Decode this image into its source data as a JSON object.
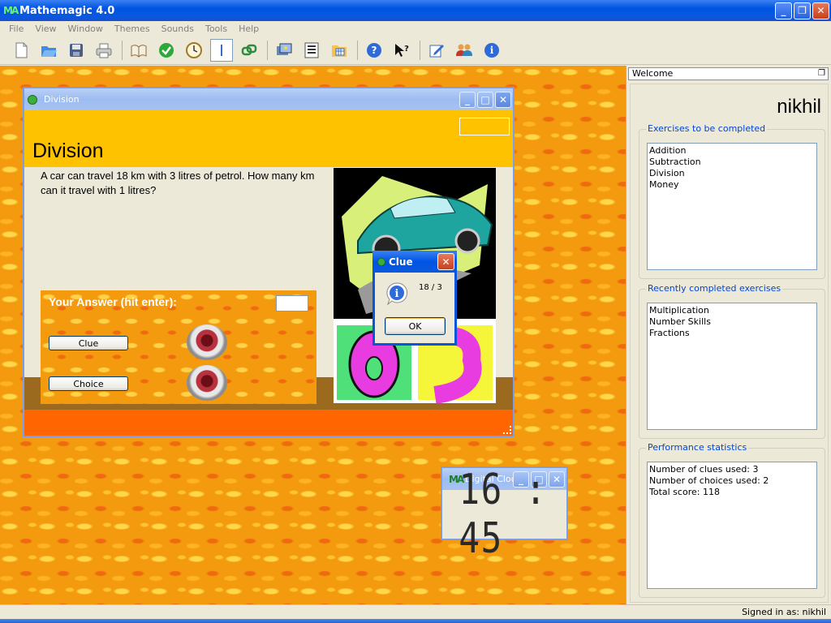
{
  "app": {
    "title": "Mathemagic 4.0",
    "logo": "MA"
  },
  "menu": [
    "File",
    "View",
    "Window",
    "Themes",
    "Sounds",
    "Tools",
    "Help"
  ],
  "toolbar": {
    "icons": [
      "new-document-icon",
      "open-folder-icon",
      "save-icon",
      "print-icon",
      "book-icon",
      "check-icon",
      "clock-icon",
      "text-cursor-icon",
      "link-icon",
      "photos-icon",
      "list-icon",
      "calendar-folder-icon",
      "help-icon",
      "whats-this-icon",
      "edit-icon",
      "users-icon",
      "info-icon"
    ]
  },
  "division_window": {
    "title": "Division",
    "heading": "Division",
    "question": "A car can travel 18 km with 3 litres of petrol. How many km can it travel with 1 litres?",
    "answer_label": "Your Answer (hit enter):",
    "answer_value": "",
    "clue_button": "Clue",
    "choice_button": "Choice"
  },
  "clue_dialog": {
    "title": "Clue",
    "message": "18 / 3",
    "ok_label": "OK"
  },
  "clock": {
    "title": "Digital Cloc",
    "time": "16 : 45"
  },
  "welcome": {
    "header": "Welcome",
    "user_name": "nikhil",
    "to_complete": {
      "label": "Exercises to be completed",
      "items": [
        "Addition",
        "Subtraction",
        "Division",
        "Money"
      ]
    },
    "recent": {
      "label": "Recently completed exercises",
      "items": [
        "Multiplication",
        "Number Skills",
        "Fractions"
      ]
    },
    "stats": {
      "label": "Performance statistics",
      "items": [
        "Number of clues used: 3",
        "Number of choices used: 2",
        "Total score: 118"
      ]
    }
  },
  "status": {
    "signed_in": "Signed in as: nikhil"
  },
  "colors": {
    "xp_blue": "#0054E3",
    "desktop_orange": "#F39A0E",
    "heading_yellow": "#FFC200",
    "footer_orange": "#FF6500",
    "group_label_blue": "#0046D5"
  }
}
